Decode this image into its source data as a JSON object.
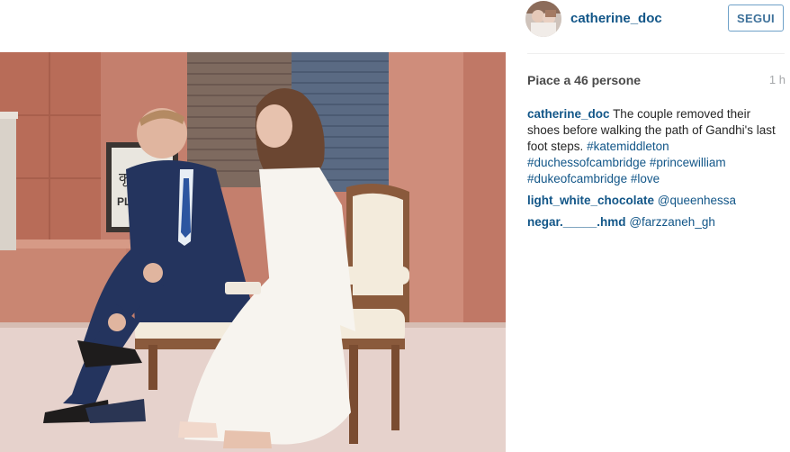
{
  "post": {
    "username": "catherine_doc",
    "follow_label": "SEGUI",
    "likes_label": "Piace a 46 persone",
    "time_ago": "1 h"
  },
  "photo": {
    "sign_text_top": "कृपया",
    "sign_text_bottom": "PLEASE"
  },
  "comments": [
    {
      "user": "catherine_doc",
      "text": "The couple removed their shoes before walking the path of Gandhi's last foot steps.",
      "hashtags": [
        "#katemiddleton",
        "#duchessofcambridge",
        "#princewilliam",
        "#dukeofcambridge",
        "#love"
      ]
    },
    {
      "user": "light_white_chocolate",
      "mention": "@queenhessa"
    },
    {
      "user": "negar._____.hmd",
      "mention": "@farzzaneh_gh"
    }
  ],
  "colors": {
    "link_blue": "#125688",
    "button_border": "#6fa1c8",
    "muted_gray": "#a5a7aa",
    "text_dark": "#262626"
  }
}
